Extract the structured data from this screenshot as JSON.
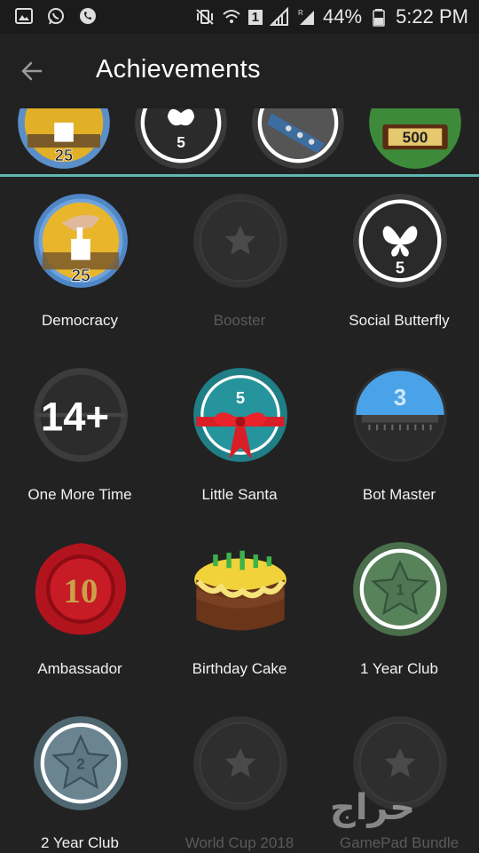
{
  "status_bar": {
    "battery": "44%",
    "time": "5:22 PM",
    "sim_label": "1"
  },
  "app_bar": {
    "title": "Achievements"
  },
  "strip": {
    "badges": [
      {
        "icon": "democracy-badge-icon",
        "number": "25"
      },
      {
        "icon": "social-butterfly-badge-icon",
        "number": "5"
      },
      {
        "icon": "sash-badge-icon"
      },
      {
        "icon": "crate-badge-icon",
        "number": "500"
      }
    ]
  },
  "achievements": [
    {
      "name": "Democracy",
      "locked": false,
      "badge": "democracy",
      "number": "25"
    },
    {
      "name": "Booster",
      "locked": true,
      "badge": "locked-star"
    },
    {
      "name": "Social Butterfly",
      "locked": false,
      "badge": "butterfly",
      "number": "5"
    },
    {
      "name": "One More Time",
      "locked": false,
      "badge": "flip-counter",
      "number": "14+"
    },
    {
      "name": "Little Santa",
      "locked": false,
      "badge": "gift-ribbon",
      "number": "5"
    },
    {
      "name": "Bot Master",
      "locked": false,
      "badge": "bot-dome",
      "number": "3"
    },
    {
      "name": "Ambassador",
      "locked": false,
      "badge": "wax-seal",
      "number": "10"
    },
    {
      "name": "Birthday Cake",
      "locked": false,
      "badge": "cake"
    },
    {
      "name": "1 Year Club",
      "locked": false,
      "badge": "green-star",
      "number": "1"
    },
    {
      "name": "2 Year Club",
      "locked": false,
      "badge": "blue-star",
      "number": "2"
    },
    {
      "name": "World Cup 2018",
      "locked": true,
      "badge": "locked-star"
    },
    {
      "name": "GamePad Bundle",
      "locked": true,
      "badge": "locked-star"
    }
  ],
  "watermark_text": "حراج",
  "colors": {
    "accent_line": "#5fb8b0",
    "background": "#222222",
    "locked_label": "#5a5a5a"
  }
}
